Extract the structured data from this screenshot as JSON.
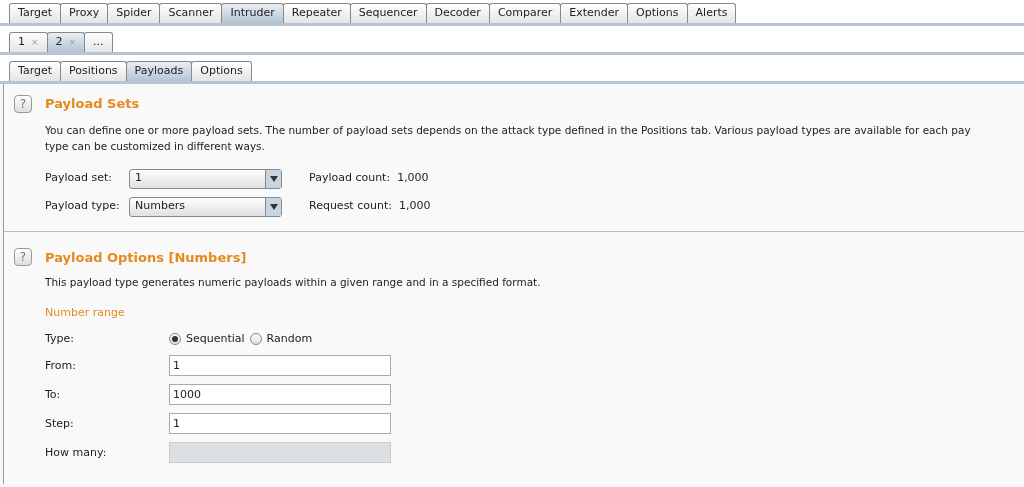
{
  "main_tabs": [
    {
      "label": "Target",
      "selected": false
    },
    {
      "label": "Proxy",
      "selected": false
    },
    {
      "label": "Spider",
      "selected": false
    },
    {
      "label": "Scanner",
      "selected": false
    },
    {
      "label": "Intruder",
      "selected": true
    },
    {
      "label": "Repeater",
      "selected": false
    },
    {
      "label": "Sequencer",
      "selected": false
    },
    {
      "label": "Decoder",
      "selected": false
    },
    {
      "label": "Comparer",
      "selected": false
    },
    {
      "label": "Extender",
      "selected": false
    },
    {
      "label": "Options",
      "selected": false
    },
    {
      "label": "Alerts",
      "selected": false
    }
  ],
  "attack_tabs": [
    {
      "label": "1",
      "close": "×",
      "selected": false
    },
    {
      "label": "2",
      "close": "×",
      "selected": true
    },
    {
      "label": "...",
      "selected": false
    }
  ],
  "sub_tabs": [
    {
      "label": "Target",
      "selected": false
    },
    {
      "label": "Positions",
      "selected": false
    },
    {
      "label": "Payloads",
      "selected": true
    },
    {
      "label": "Options",
      "selected": false
    }
  ],
  "payload_sets": {
    "help": "?",
    "title": "Payload Sets",
    "description": "You can define one or more payload sets. The number of payload sets depends on the attack type defined in the Positions tab. Various payload types are available for each pay",
    "description_2": "type can be customized in different ways.",
    "rows": [
      {
        "label": "Payload set:",
        "value": "1",
        "info": "Payload count:  1,000"
      },
      {
        "label": "Payload type:",
        "value": "Numbers",
        "info": "Request count:  1,000"
      }
    ]
  },
  "payload_options": {
    "help": "?",
    "title": "Payload Options [Numbers]",
    "description": "This payload type generates numeric payloads within a given range and in a specified format.",
    "subheading": "Number range",
    "type": {
      "label": "Type:",
      "options": [
        {
          "label": "Sequential",
          "selected": true
        },
        {
          "label": "Random",
          "selected": false
        }
      ]
    },
    "fields": [
      {
        "label": "From:",
        "value": "1",
        "disabled": false
      },
      {
        "label": "To:",
        "value": "1000",
        "disabled": false
      },
      {
        "label": "Step:",
        "value": "1",
        "disabled": false
      },
      {
        "label": "How many:",
        "disabled": true
      }
    ]
  }
}
